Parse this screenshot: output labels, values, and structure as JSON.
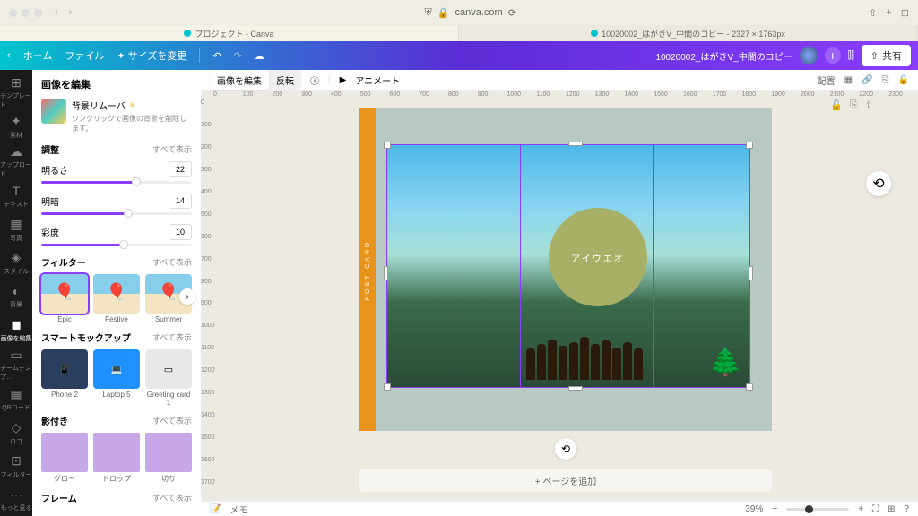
{
  "browser": {
    "url": "canva.com",
    "tabs": [
      {
        "label": "プロジェクト - Canva",
        "iconColor": "#00c4cc"
      },
      {
        "label": "10020002_はがきV_中間のコピー - 2327 × 1763px",
        "iconColor": "#00c4cc"
      }
    ]
  },
  "header": {
    "home": "ホーム",
    "file": "ファイル",
    "resize": "サイズを変更",
    "docName": "10020002_はがきV_中間のコピー",
    "share": "共有"
  },
  "rail": [
    {
      "icon": "⊞",
      "label": "テンプレート"
    },
    {
      "icon": "✦",
      "label": "素材"
    },
    {
      "icon": "☁",
      "label": "アップロード"
    },
    {
      "icon": "T",
      "label": "テキスト"
    },
    {
      "icon": "▦",
      "label": "写真"
    },
    {
      "icon": "◈",
      "label": "スタイル"
    },
    {
      "icon": "◐",
      "label": "背景"
    },
    {
      "icon": "◼",
      "label": "画像を編集"
    },
    {
      "icon": "▭",
      "label": "チームテンプ…"
    },
    {
      "icon": "▦",
      "label": "QRコード"
    },
    {
      "icon": "◇",
      "label": "ロゴ"
    },
    {
      "icon": "⊡",
      "label": "フィルター"
    },
    {
      "icon": "⋯",
      "label": "もっと見る"
    }
  ],
  "panel": {
    "title": "画像を編集",
    "bgRemover": {
      "name": "背景リムーバ",
      "desc": "ワンクリックで画像の背景を削除します。"
    },
    "adjust": {
      "title": "調整",
      "showAll": "すべて表示",
      "sliders": [
        {
          "label": "明るさ",
          "value": "22"
        },
        {
          "label": "明暗",
          "value": "14"
        },
        {
          "label": "彩度",
          "value": "10"
        }
      ]
    },
    "filter": {
      "title": "フィルター",
      "showAll": "すべて表示",
      "items": [
        {
          "label": "Epic"
        },
        {
          "label": "Festive"
        },
        {
          "label": "Summer"
        }
      ]
    },
    "mockup": {
      "title": "スマートモックアップ",
      "showAll": "すべて表示",
      "items": [
        {
          "label": "Phone 2"
        },
        {
          "label": "Laptop 5"
        },
        {
          "label": "Greeting card 1"
        }
      ]
    },
    "shadow": {
      "title": "影付き",
      "showAll": "すべて表示",
      "items": [
        {
          "label": "グロー"
        },
        {
          "label": "ドロップ"
        },
        {
          "label": "切り"
        }
      ]
    },
    "frame": {
      "title": "フレーム",
      "showAll": "すべて表示"
    }
  },
  "toolbar": {
    "edit": "画像を編集",
    "flip": "反転",
    "animate": "アニメート",
    "position": "配置"
  },
  "ruler": {
    "h": [
      "0",
      "100",
      "200",
      "300",
      "400",
      "500",
      "600",
      "700",
      "800",
      "900",
      "1000",
      "1100",
      "1200",
      "1300",
      "1400",
      "1500",
      "1600",
      "1700",
      "1800",
      "1900",
      "2000",
      "2100",
      "2200",
      "2300"
    ],
    "v": [
      "0",
      "100",
      "200",
      "300",
      "400",
      "500",
      "600",
      "700",
      "800",
      "900",
      "1000",
      "1100",
      "1200",
      "1300",
      "1400",
      "1500",
      "1600",
      "1700"
    ]
  },
  "design": {
    "postcard": "POST CARD",
    "circleText": "アイウエオ",
    "addPage": "+ ページを追加"
  },
  "footer": {
    "notes": "メモ",
    "zoom": "39%"
  }
}
